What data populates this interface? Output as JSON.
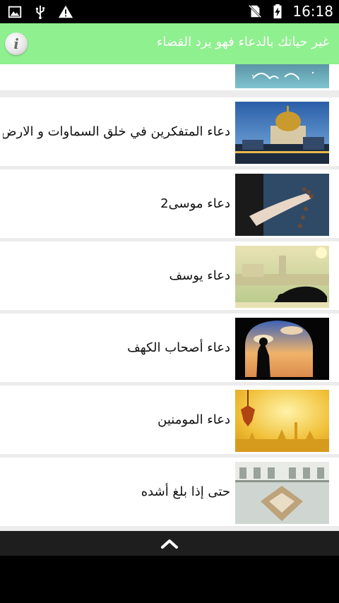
{
  "status_bar": {
    "time": "16:18",
    "icons_left": [
      "image-icon",
      "usb-icon",
      "alert-icon"
    ],
    "icons_right": [
      "no-sim-icon",
      "battery-charging-icon"
    ]
  },
  "header": {
    "title": "غير حياتك بالدعاء فهو يرد القضاء",
    "info_symbol": "i",
    "background": "#8ef08e"
  },
  "list": {
    "items": [
      {
        "label": "",
        "thumb": "calligraphy-night"
      },
      {
        "label": "دعاء المتفكرين في خلق السماوات و الارض",
        "thumb": "mosque-dome"
      },
      {
        "label": "دعاء  موسى2",
        "thumb": "prayer-beads"
      },
      {
        "label": "دعاء يوسف",
        "thumb": "sujood-silhouette"
      },
      {
        "label": "دعاء أصحاب الكهف",
        "thumb": "cave-window-prayer"
      },
      {
        "label": "دعاء المومنين",
        "thumb": "lantern-golden"
      },
      {
        "label": "حتى إذا بلغ أشده",
        "thumb": "mosque-courtyard"
      }
    ]
  },
  "bottom_bar": {
    "button": "chevron-up-icon"
  }
}
